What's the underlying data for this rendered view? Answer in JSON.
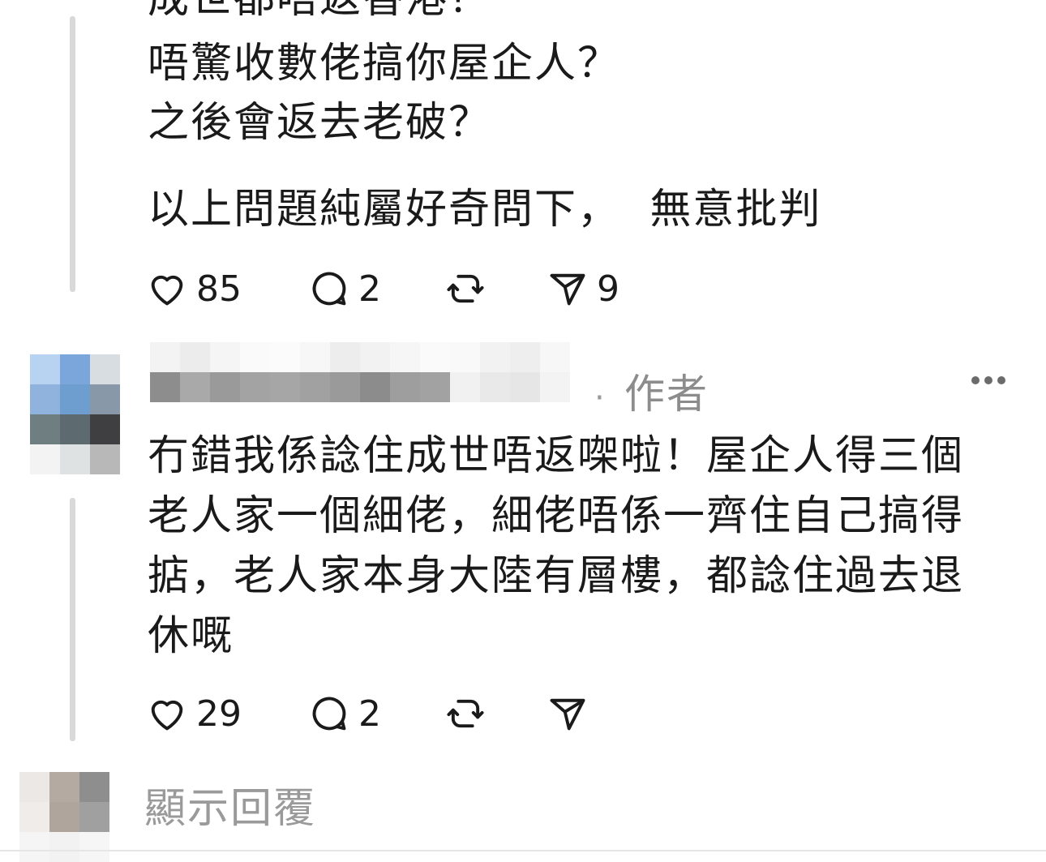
{
  "post": {
    "cut_line": "成世都唔返香港？",
    "line1": "唔驚收數佬搞你屋企人？",
    "line2": "之後會返去老破？",
    "line3": "以上問題純屬好奇問下，  無意批判",
    "actions": {
      "likes": "85",
      "replies": "2",
      "shares": "9"
    }
  },
  "reply": {
    "author_tag": "作者",
    "text": "冇錯我係諗住成世唔返㗎啦！屋企人得三個老人家一個細佬，細佬唔係一齊住自己搞得掂，老人家本身大陸有層樓，都諗住過去退休嘅",
    "actions": {
      "likes": "29",
      "replies": "2",
      "shares": ""
    }
  },
  "footer": {
    "show_replies": "顯示回覆"
  },
  "icons": [
    "heart-icon",
    "comment-icon",
    "repost-icon",
    "share-icon",
    "more-icon"
  ],
  "colors": {
    "text": "#1a1a1a",
    "muted": "#8c8c8c",
    "thread_line": "#d9d9d9"
  }
}
